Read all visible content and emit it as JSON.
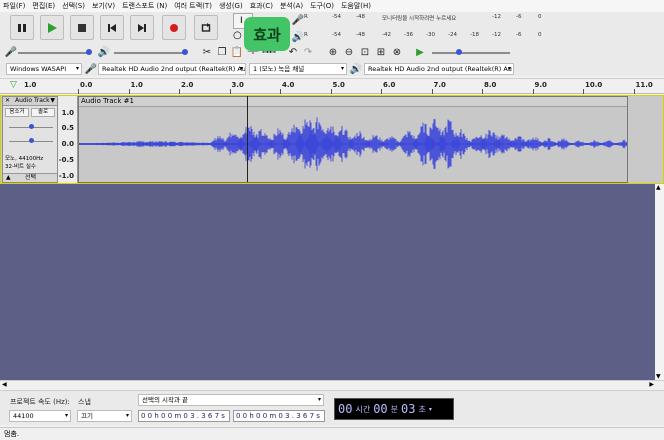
{
  "menu": [
    "파일(F)",
    "편집(E)",
    "선택(S)",
    "보기(V)",
    "트랜스포트 (N)",
    "여러 트랙(T)",
    "생성(G)",
    "효과(C)",
    "분석(A)",
    "도구(O)",
    "도움말(H)"
  ],
  "tooltip": "효과",
  "meters": {
    "record_ticks": [
      "-54",
      "-48",
      "모니터링을 시작하려면 누르세요",
      "-12",
      "-6",
      "0"
    ],
    "play_ticks": [
      "-54",
      "-48",
      "-42",
      "-36",
      "-30",
      "-24",
      "-18",
      "-12",
      "-6",
      "0"
    ],
    "record_channel": "R",
    "play_channel": "R"
  },
  "device": {
    "host": "Windows WASAPI",
    "record_device": "Realtek HD Audio 2nd output (Realtek(R) Au",
    "channels": "1 (모노) 녹음 채널",
    "play_device": "Realtek HD Audio 2nd output (Realtek(R) Au"
  },
  "timeline": {
    "start_label": "1.0",
    "ticks": [
      "0.0",
      "1.0",
      "2.0",
      "3.0",
      "4.0",
      "5.0",
      "6.0",
      "7.0",
      "8.0",
      "9.0",
      "10.0",
      "11.0"
    ]
  },
  "track": {
    "name": "Audio Track",
    "mute_label": "음소거",
    "solo_label": "솔로",
    "info_line1": "모노, 44100Hz",
    "info_line2": "32-비트 실수",
    "select_label": "선택",
    "clip_title": "Audio Track #1",
    "scale": [
      "1.0",
      "0.5",
      "0.0",
      "-0.5",
      "-1.0"
    ]
  },
  "bottom": {
    "rate_label": "프로젝트 속도 (Hz):",
    "rate_value": "44100",
    "snap_label": "스냅",
    "snap_value": "끄기",
    "selection_label": "선택의 시작과 끝",
    "start_time": "0 0 h 0 0 m 0 3 . 3 6 7 s",
    "end_time": "0 0 h 0 0 m 0 3 . 3 6 7 s",
    "big_hours": "00",
    "big_hours_unit": "시간",
    "big_min": "00",
    "big_min_unit": "분",
    "big_sec": "03",
    "big_sec_unit": "초"
  },
  "status": "멈춤.",
  "colors": {
    "waveform": "#3d48d8",
    "empty_area": "#5c5f86",
    "play_green": "#2e9e2e",
    "record_red": "#d21e1e",
    "tooltip_green": "#43c467"
  }
}
